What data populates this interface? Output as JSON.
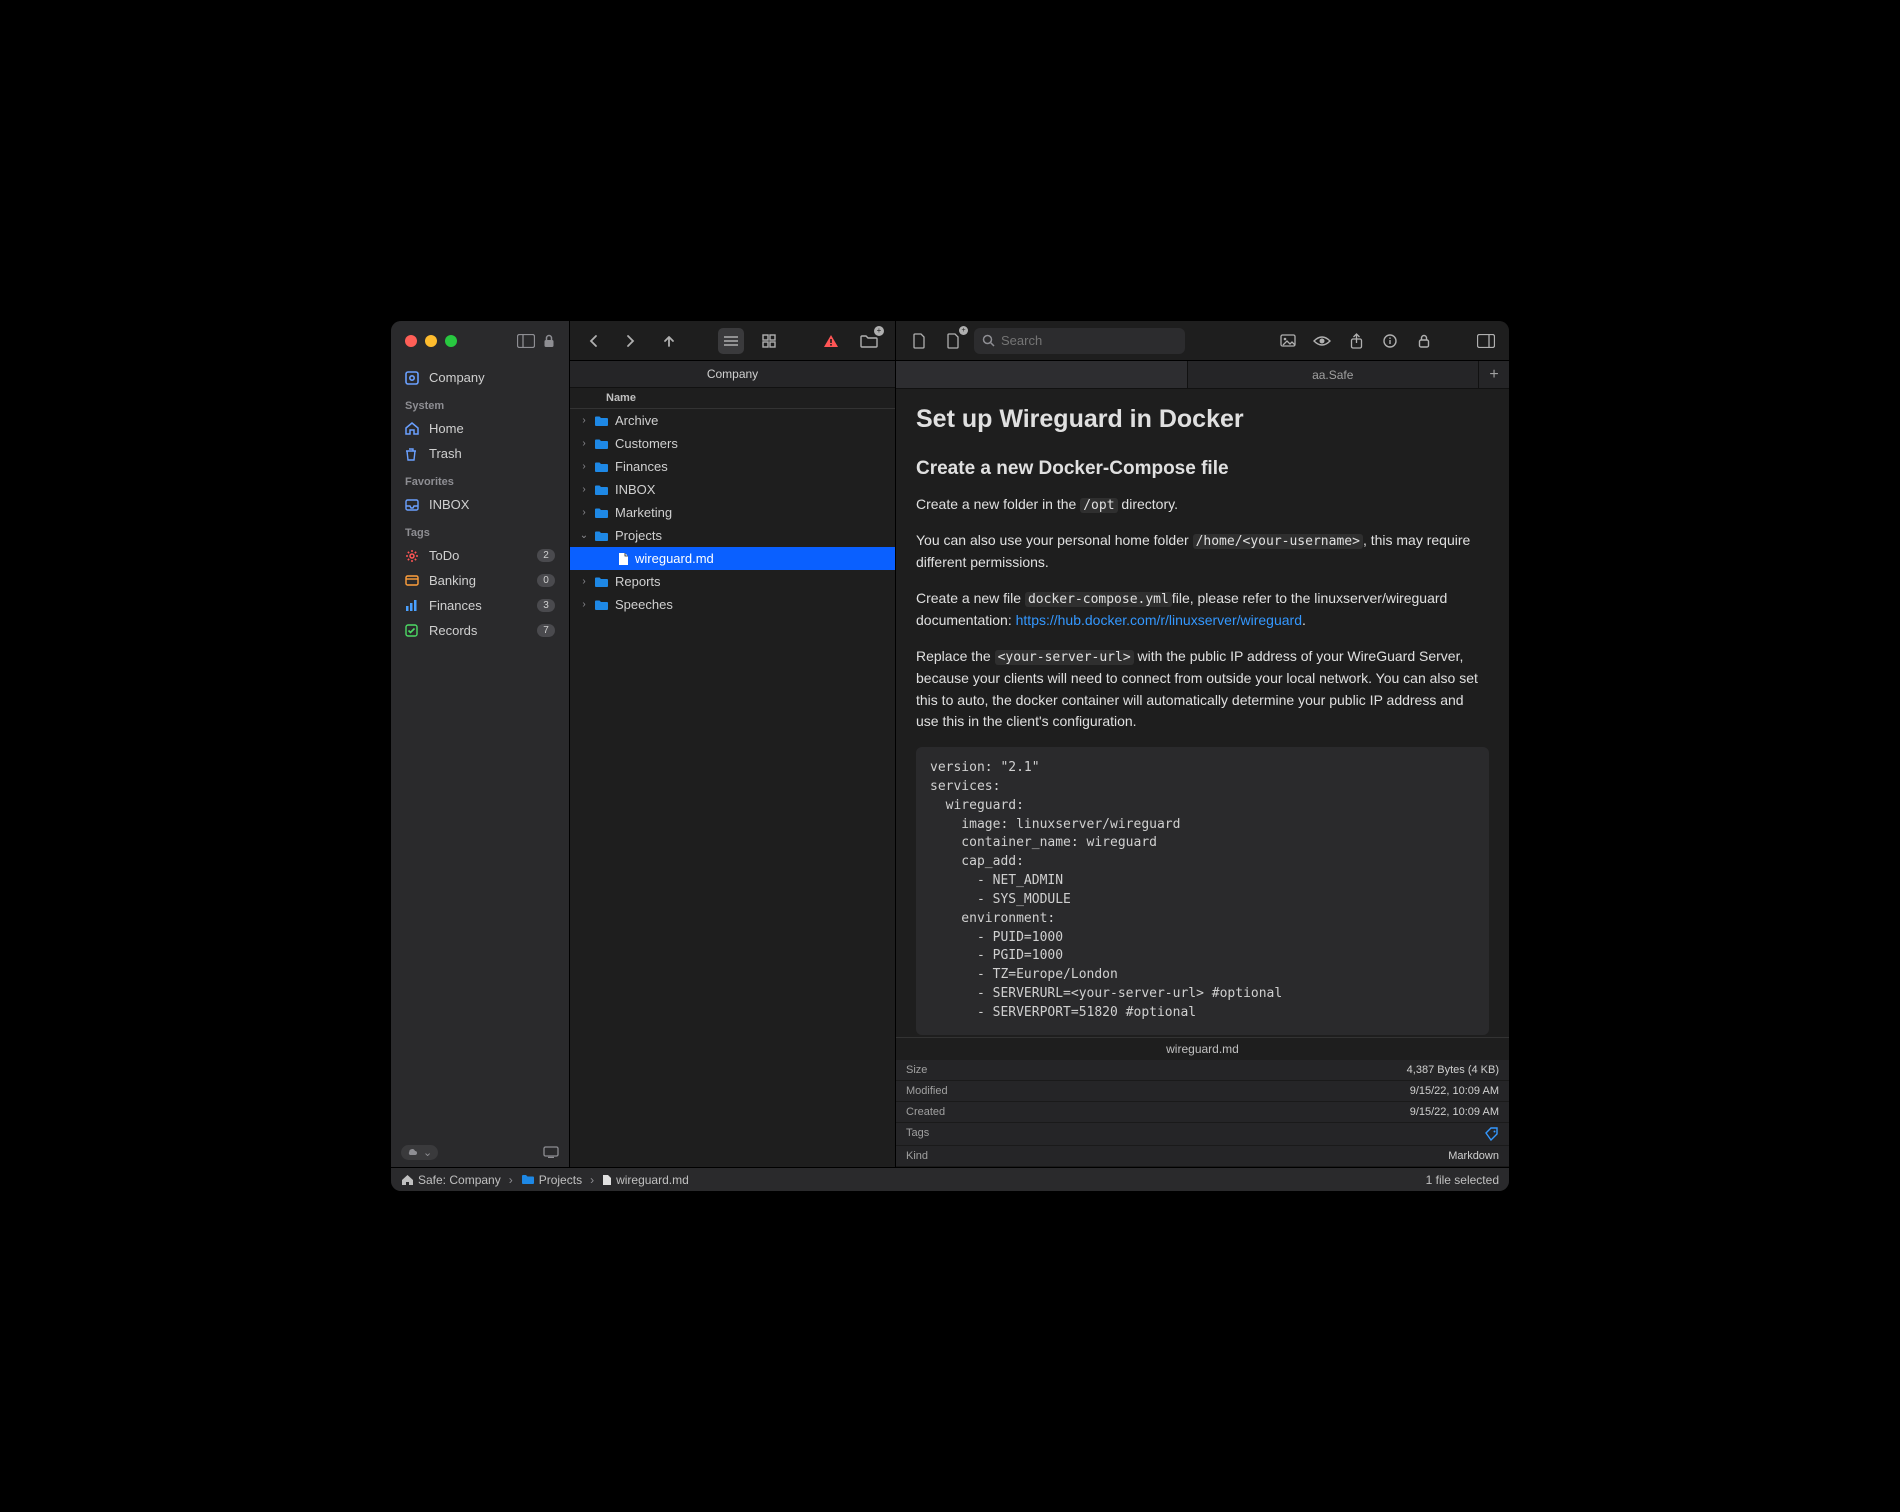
{
  "sidebar": {
    "title": "Company",
    "groups": [
      {
        "label": "System",
        "items": [
          {
            "icon": "home",
            "label": "Home",
            "color": "#6aa0ff"
          },
          {
            "icon": "trash",
            "label": "Trash",
            "color": "#6aa0ff"
          }
        ]
      },
      {
        "label": "Favorites",
        "items": [
          {
            "icon": "inbox",
            "label": "INBOX",
            "color": "#6aa0ff"
          }
        ]
      },
      {
        "label": "Tags",
        "items": [
          {
            "icon": "gear",
            "label": "ToDo",
            "badge": "2",
            "color": "#ff5555"
          },
          {
            "icon": "card",
            "label": "Banking",
            "badge": "0",
            "color": "#ff9f3c"
          },
          {
            "icon": "chart",
            "label": "Finances",
            "badge": "3",
            "color": "#4aa0ff"
          },
          {
            "icon": "check",
            "label": "Records",
            "badge": "7",
            "color": "#4cd964"
          }
        ]
      }
    ]
  },
  "filelist": {
    "header": "Company",
    "column_name": "Name",
    "items": [
      {
        "type": "folder",
        "label": "Archive",
        "expanded": false
      },
      {
        "type": "folder",
        "label": "Customers",
        "expanded": false
      },
      {
        "type": "folder",
        "label": "Finances",
        "expanded": false
      },
      {
        "type": "folder",
        "label": "INBOX",
        "expanded": false
      },
      {
        "type": "folder",
        "label": "Marketing",
        "expanded": false
      },
      {
        "type": "folder",
        "label": "Projects",
        "expanded": true,
        "children": [
          {
            "type": "file",
            "label": "wireguard.md",
            "selected": true
          }
        ]
      },
      {
        "type": "folder",
        "label": "Reports",
        "expanded": false
      },
      {
        "type": "folder",
        "label": "Speeches",
        "expanded": false
      }
    ]
  },
  "search_placeholder": "Search",
  "tabs": {
    "blank": "",
    "active": "aa.Safe"
  },
  "document": {
    "title": "Set up Wireguard in Docker",
    "h2": "Create a new Docker-Compose file",
    "p1_a": "Create a new folder in the ",
    "p1_code": "/opt",
    "p1_b": " directory.",
    "p2_a": "You can also use your personal home folder ",
    "p2_code": "/home/<your-username>",
    "p2_b": ", this may require different permissions.",
    "p3_a": "Create a new file ",
    "p3_code": "docker-compose.yml",
    "p3_b": "file, please refer to the linuxserver/wireguard documentation: ",
    "p3_link": "https://hub.docker.com/r/linuxserver/wireguard",
    "p3_c": ".",
    "p4_a": "Replace the ",
    "p4_code": "<your-server-url>",
    "p4_b": " with the public IP address of your WireGuard Server, because your clients will need to connect from outside your local network. You can also set this to auto, the docker container will automatically determine your public IP address and use this in the client's configuration.",
    "codeblock": "version: \"2.1\"\nservices:\n  wireguard:\n    image: linuxserver/wireguard\n    container_name: wireguard\n    cap_add:\n      - NET_ADMIN\n      - SYS_MODULE\n    environment:\n      - PUID=1000\n      - PGID=1000\n      - TZ=Europe/London\n      - SERVERURL=<your-server-url> #optional\n      - SERVERPORT=51820 #optional",
    "filename": "wireguard.md"
  },
  "info": {
    "size_label": "Size",
    "size_value": "4,387 Bytes (4 KB)",
    "modified_label": "Modified",
    "modified_value": "9/15/22, 10:09 AM",
    "created_label": "Created",
    "created_value": "9/15/22, 10:09 AM",
    "tags_label": "Tags",
    "kind_label": "Kind",
    "kind_value": "Markdown"
  },
  "breadcrumb": {
    "safe": "Safe: Company",
    "folder": "Projects",
    "file": "wireguard.md"
  },
  "status_right": "1 file selected"
}
